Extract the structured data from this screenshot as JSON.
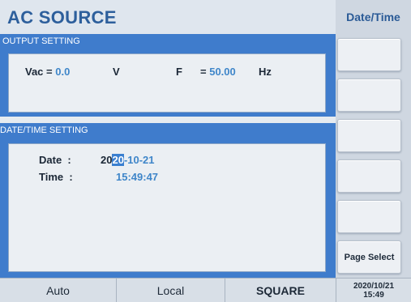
{
  "header": {
    "title": "AC SOURCE"
  },
  "softkeys": {
    "title": "Date/Time",
    "buttons": [
      "",
      "",
      "",
      "",
      "",
      "",
      "Page Select"
    ]
  },
  "output_setting": {
    "title": "OUTPUT SETTING",
    "vac_label": "Vac = ",
    "vac_value": "0.0",
    "vac_unit": "V",
    "freq_label": "F",
    "freq_eq": "= ",
    "freq_value": "50.00",
    "freq_unit": "Hz"
  },
  "datetime_setting": {
    "title": "DATE/TIME SETTING",
    "date_label": "Date  :",
    "date_prefix": "20",
    "date_cursor": "20",
    "date_rest": "-10-21",
    "time_label": "Time  :",
    "time_value": "15:49:47"
  },
  "status_bar": {
    "mode": "Auto",
    "control": "Local",
    "waveform": "SQUARE",
    "clock_date": "2020/10/21",
    "clock_time": "15:49"
  }
}
